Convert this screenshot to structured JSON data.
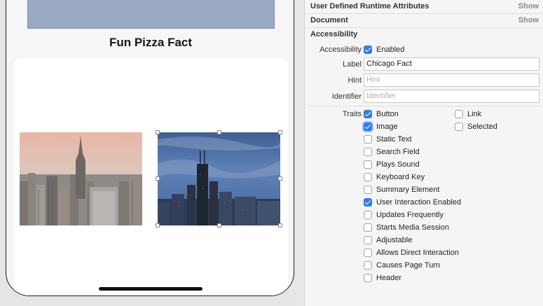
{
  "canvas": {
    "fact_title": "Fun Pizza Fact"
  },
  "inspector": {
    "sections": [
      {
        "title": "User Defined Runtime Attributes",
        "action": "Show"
      },
      {
        "title": "Document",
        "action": "Show"
      }
    ],
    "accessibility": {
      "title": "Accessibility",
      "accessibility_label": "Accessibility",
      "enabled_label": "Enabled",
      "enabled": true,
      "label_caption": "Label",
      "label_value": "Chicago Fact",
      "hint_caption": "Hint",
      "hint_placeholder": "Hint",
      "identifier_caption": "Identifier",
      "identifier_placeholder": "Identifier",
      "traits_caption": "Traits",
      "traits_left": [
        {
          "label": "Button",
          "checked": true
        },
        {
          "label": "Image",
          "checked": true
        },
        {
          "label": "Static Text",
          "checked": false
        },
        {
          "label": "Search Field",
          "checked": false
        },
        {
          "label": "Plays Sound",
          "checked": false
        },
        {
          "label": "Keyboard Key",
          "checked": false
        },
        {
          "label": "Summary Element",
          "checked": false
        },
        {
          "label": "User Interaction Enabled",
          "checked": true
        },
        {
          "label": "Updates Frequently",
          "checked": false
        },
        {
          "label": "Starts Media Session",
          "checked": false
        },
        {
          "label": "Adjustable",
          "checked": false
        },
        {
          "label": "Allows Direct Interaction",
          "checked": false
        },
        {
          "label": "Causes Page Turn",
          "checked": false
        },
        {
          "label": "Header",
          "checked": false
        }
      ],
      "traits_right": [
        {
          "label": "Link",
          "checked": false
        },
        {
          "label": "Selected",
          "checked": false
        }
      ]
    }
  }
}
